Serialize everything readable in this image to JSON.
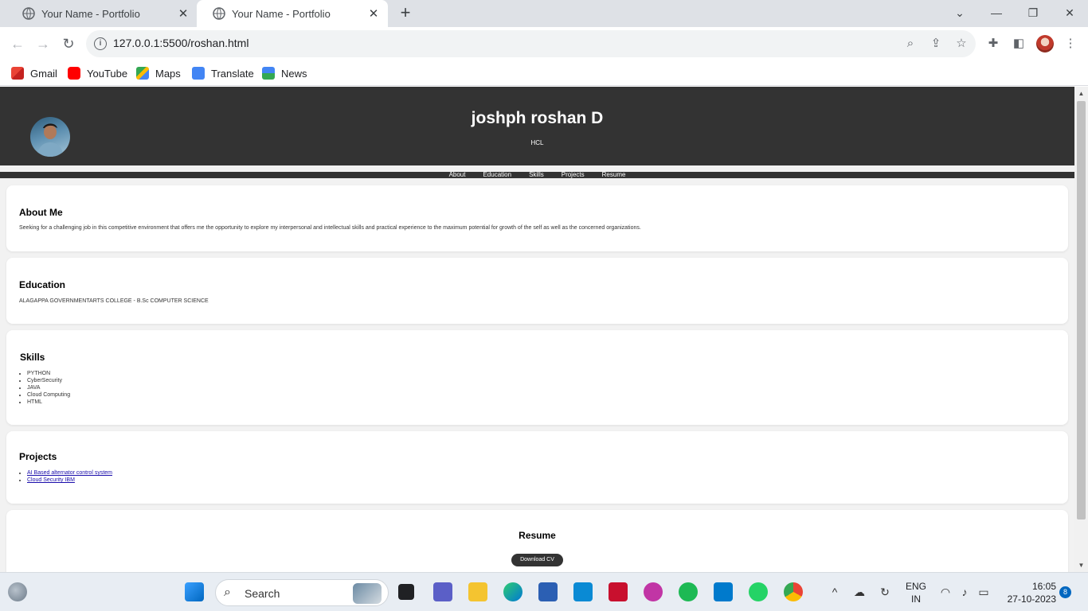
{
  "browser": {
    "tabs": [
      {
        "title": "Your Name - Portfolio",
        "active": false
      },
      {
        "title": "Your Name - Portfolio",
        "active": true
      }
    ],
    "new_tab": "+",
    "url": "127.0.0.1:5500/roshan.html",
    "bookmarks": [
      {
        "label": "Gmail",
        "icon": "gmail-icon",
        "color": "#ea4335"
      },
      {
        "label": "YouTube",
        "icon": "youtube-icon",
        "color": "#ff0000"
      },
      {
        "label": "Maps",
        "icon": "maps-icon",
        "color": "#34a853"
      },
      {
        "label": "Translate",
        "icon": "translate-icon",
        "color": "#4285f4"
      },
      {
        "label": "News",
        "icon": "news-icon",
        "color": "#4285f4"
      }
    ]
  },
  "site": {
    "name": "joshph roshan D",
    "subtitle": "HCL",
    "nav": [
      "About",
      "Education",
      "Skills",
      "Projects",
      "Resume"
    ],
    "about": {
      "heading": "About Me",
      "text": "Seeking for a challenging job in this competitive environment that offers me the opportunity to explore my interpersonal and intellectual skills and practical experience to the maximum potential for growth of the self as well as the concerned organizations."
    },
    "education": {
      "heading": "Education",
      "text": "ALAGAPPA GOVERNMENTARTS COLLEGE - B.Sc COMPUTER SCIENCE"
    },
    "skills": {
      "heading": "Skills",
      "items": [
        "PYTHON",
        "CyberSecurity",
        "JAVA",
        "Cloud Computing",
        "HTML"
      ]
    },
    "projects": {
      "heading": "Projects",
      "items": [
        "AI Based alternator control system",
        "Cloud Security IBM"
      ]
    },
    "resume": {
      "heading": "Resume",
      "button": "Download CV"
    },
    "colors": {
      "header_bg": "#333333",
      "page_bg": "#f2f2f2",
      "card_bg": "#ffffff"
    }
  },
  "taskbar": {
    "search_label": "Search",
    "lang_top": "ENG",
    "lang_bottom": "IN",
    "time": "16:05",
    "date": "27-10-2023",
    "notifications": "8"
  }
}
